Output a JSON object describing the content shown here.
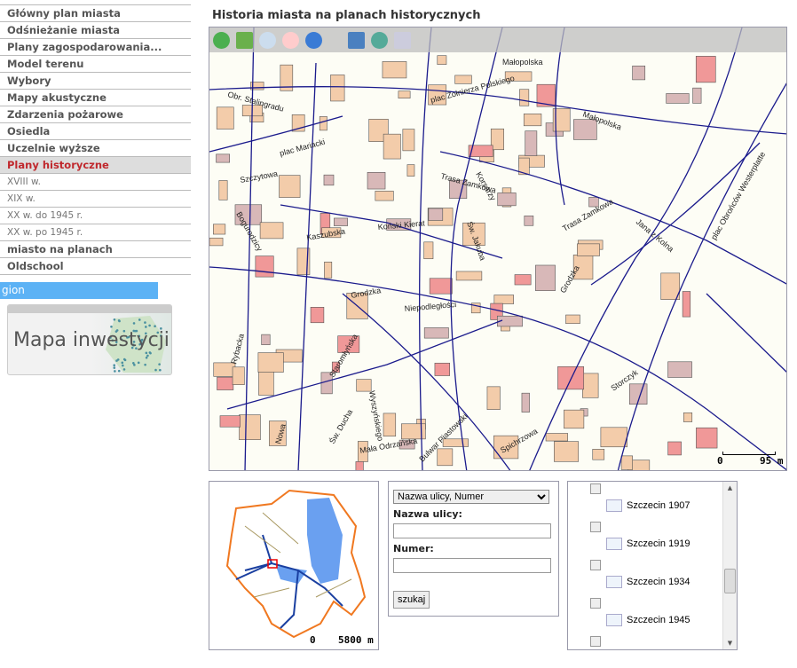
{
  "nav": {
    "items": [
      {
        "label": "Główny plan miasta",
        "type": "main"
      },
      {
        "label": "Odśnieżanie miasta",
        "type": "main"
      },
      {
        "label": "Plany zagospodarowania...",
        "type": "main"
      },
      {
        "label": "Model terenu",
        "type": "main"
      },
      {
        "label": "Wybory",
        "type": "main"
      },
      {
        "label": "Mapy akustyczne",
        "type": "main"
      },
      {
        "label": "Zdarzenia pożarowe",
        "type": "main"
      },
      {
        "label": "Osiedla",
        "type": "main"
      },
      {
        "label": "Uczelnie wyższe",
        "type": "main"
      },
      {
        "label": "Plany historyczne",
        "type": "active"
      },
      {
        "label": "XVIII w.",
        "type": "sub"
      },
      {
        "label": "XIX w.",
        "type": "sub"
      },
      {
        "label": "XX w. do 1945 r.",
        "type": "sub"
      },
      {
        "label": "XX w. po 1945 r.",
        "type": "sub"
      },
      {
        "label": "miasto na planach",
        "type": "main"
      },
      {
        "label": "Oldschool",
        "type": "main"
      }
    ],
    "region": "gion",
    "banner": "Mapa inwestycji"
  },
  "page_title": "Historia miasta na planach historycznych",
  "toolbar": [
    "globe-icon",
    "zoom-extent-icon",
    "zoom-in-icon",
    "zoom-out-icon",
    "info-icon",
    "window-icon",
    "refresh-print-icon",
    "print-icon"
  ],
  "map": {
    "streets": [
      "Małopolska",
      "plac Żołnierza Polskiego",
      "Obr. Stalingradu",
      "Małopolska",
      "Trasa Zamkowa",
      "plac Mariacki",
      "Szczytowa",
      "Bogurodzicy",
      "Kaszubska",
      "Koński Kierat",
      "Korsarzy",
      "Trasa Zamkowa",
      "Jana z Kolna",
      "plac Obrońców Westerplatte",
      "Grodzka",
      "Grodzka",
      "Św. Jakuba",
      "Niepodległości",
      "Rybacka",
      "Staromłyńska",
      "Wyszyńskiego",
      "Nowa",
      "Św. Ducha",
      "Mała Odrzańska",
      "Bulwar Piastowski",
      "Spichrzowa",
      "Storczyk"
    ],
    "scale": {
      "zero": "0",
      "value": "95 m"
    }
  },
  "overview": {
    "scale": {
      "zero": "0",
      "value": "5800 m"
    }
  },
  "search": {
    "mode": "Nazwa ulicy, Numer",
    "street_label": "Nazwa ulicy:",
    "street_value": "",
    "number_label": "Numer:",
    "number_value": "",
    "button": "szukaj"
  },
  "layers": [
    {
      "label": "Szczecin 1907",
      "checked": false
    },
    {
      "label": "Szczecin 1919",
      "checked": false
    },
    {
      "label": "Szczecin 1934",
      "checked": false
    },
    {
      "label": "Szczecin 1945",
      "checked": false
    }
  ],
  "colors": {
    "active_nav": "#c0282d",
    "region_bar": "#5cb2f5",
    "streets": "#1a1a8c",
    "buildings": "#f0c8a8",
    "highlight": "#f09898"
  }
}
